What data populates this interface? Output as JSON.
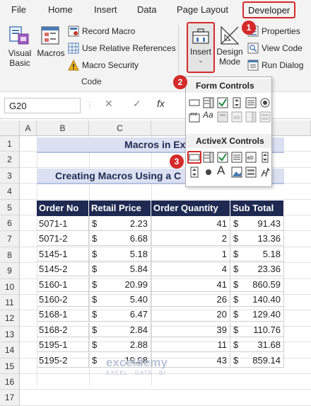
{
  "ribbon": {
    "tabs": [
      "File",
      "Home",
      "Insert",
      "Data",
      "Page Layout",
      "Developer"
    ],
    "active_tab": "Developer",
    "code_group": {
      "visual_basic": "Visual\nBasic",
      "visual_basic_l1": "Visual",
      "visual_basic_l2": "Basic",
      "macros": "Macros",
      "record_macro": "Record Macro",
      "relative_refs": "Use Relative References",
      "macro_security": "Macro Security",
      "label": "Code"
    },
    "controls_group": {
      "insert": "Insert",
      "design_mode_l1": "Design",
      "design_mode_l2": "Mode",
      "properties": "Properties",
      "view_code": "View Code",
      "run_dialog": "Run Dialog"
    }
  },
  "callouts": [
    "1",
    "2",
    "3"
  ],
  "insert_dropdown": {
    "form_controls_title": "Form Controls",
    "activex_controls_title": "ActiveX Controls",
    "form_icons": [
      "button-icon",
      "combo-box-icon",
      "checkbox-icon",
      "spin-button-icon",
      "list-box-icon",
      "option-button-icon",
      "group-box-icon",
      "label-icon",
      "scroll-bar-icon",
      "text-field-icon",
      "combo-list-icon",
      "combo-drop-icon"
    ],
    "form_label_glyph": "Aa",
    "form_group_glyph": "XYZ",
    "activex_icons": [
      "command-button-icon",
      "combo-box-icon",
      "checkbox-icon",
      "list-box-icon",
      "text-box-icon",
      "scroll-bar-icon",
      "spin-button-icon",
      "option-button-icon",
      "label-icon",
      "image-icon",
      "toggle-button-icon",
      "more-controls-icon"
    ],
    "activex_label_glyph": "A"
  },
  "formula_bar": {
    "name_box": "G20",
    "cancel_glyph": "✕",
    "enter_glyph": "✓",
    "fx_glyph": "fx"
  },
  "sheet": {
    "columns": [
      "A",
      "B",
      "C"
    ],
    "rows": [
      "1",
      "2",
      "3",
      "4",
      "5",
      "6",
      "7",
      "8",
      "9",
      "10",
      "11",
      "12",
      "13",
      "14",
      "15",
      "16",
      "17"
    ],
    "title": "Macros in Exce",
    "subtitle": "Creating Macros Using a C",
    "headers": [
      "Order No",
      "Retail Price",
      "Order Quantity",
      "Sub Total"
    ],
    "currency_symbol": "$",
    "rows_data": [
      {
        "order": "5071-1",
        "price": "2.23",
        "qty": "41",
        "sub": "91.43"
      },
      {
        "order": "5071-2",
        "price": "6.68",
        "qty": "2",
        "sub": "13.36"
      },
      {
        "order": "5145-1",
        "price": "5.18",
        "qty": "1",
        "sub": "5.18"
      },
      {
        "order": "5145-2",
        "price": "5.84",
        "qty": "4",
        "sub": "23.36"
      },
      {
        "order": "5160-1",
        "price": "20.99",
        "qty": "41",
        "sub": "860.59"
      },
      {
        "order": "5160-2",
        "price": "5.40",
        "qty": "26",
        "sub": "140.40"
      },
      {
        "order": "5168-1",
        "price": "6.47",
        "qty": "20",
        "sub": "129.40"
      },
      {
        "order": "5168-2",
        "price": "2.84",
        "qty": "39",
        "sub": "110.76"
      },
      {
        "order": "5195-1",
        "price": "2.88",
        "qty": "11",
        "sub": "31.68"
      },
      {
        "order": "5195-2",
        "price": "19.98",
        "qty": "43",
        "sub": "859.14"
      }
    ]
  },
  "watermark": {
    "name": "exceldemy",
    "tagline": "EXCEL · DATA · BI"
  },
  "colors": {
    "accent_red": "#d42a2a",
    "table_header": "#1f2a52",
    "title_fill": "#dbe1f2"
  }
}
